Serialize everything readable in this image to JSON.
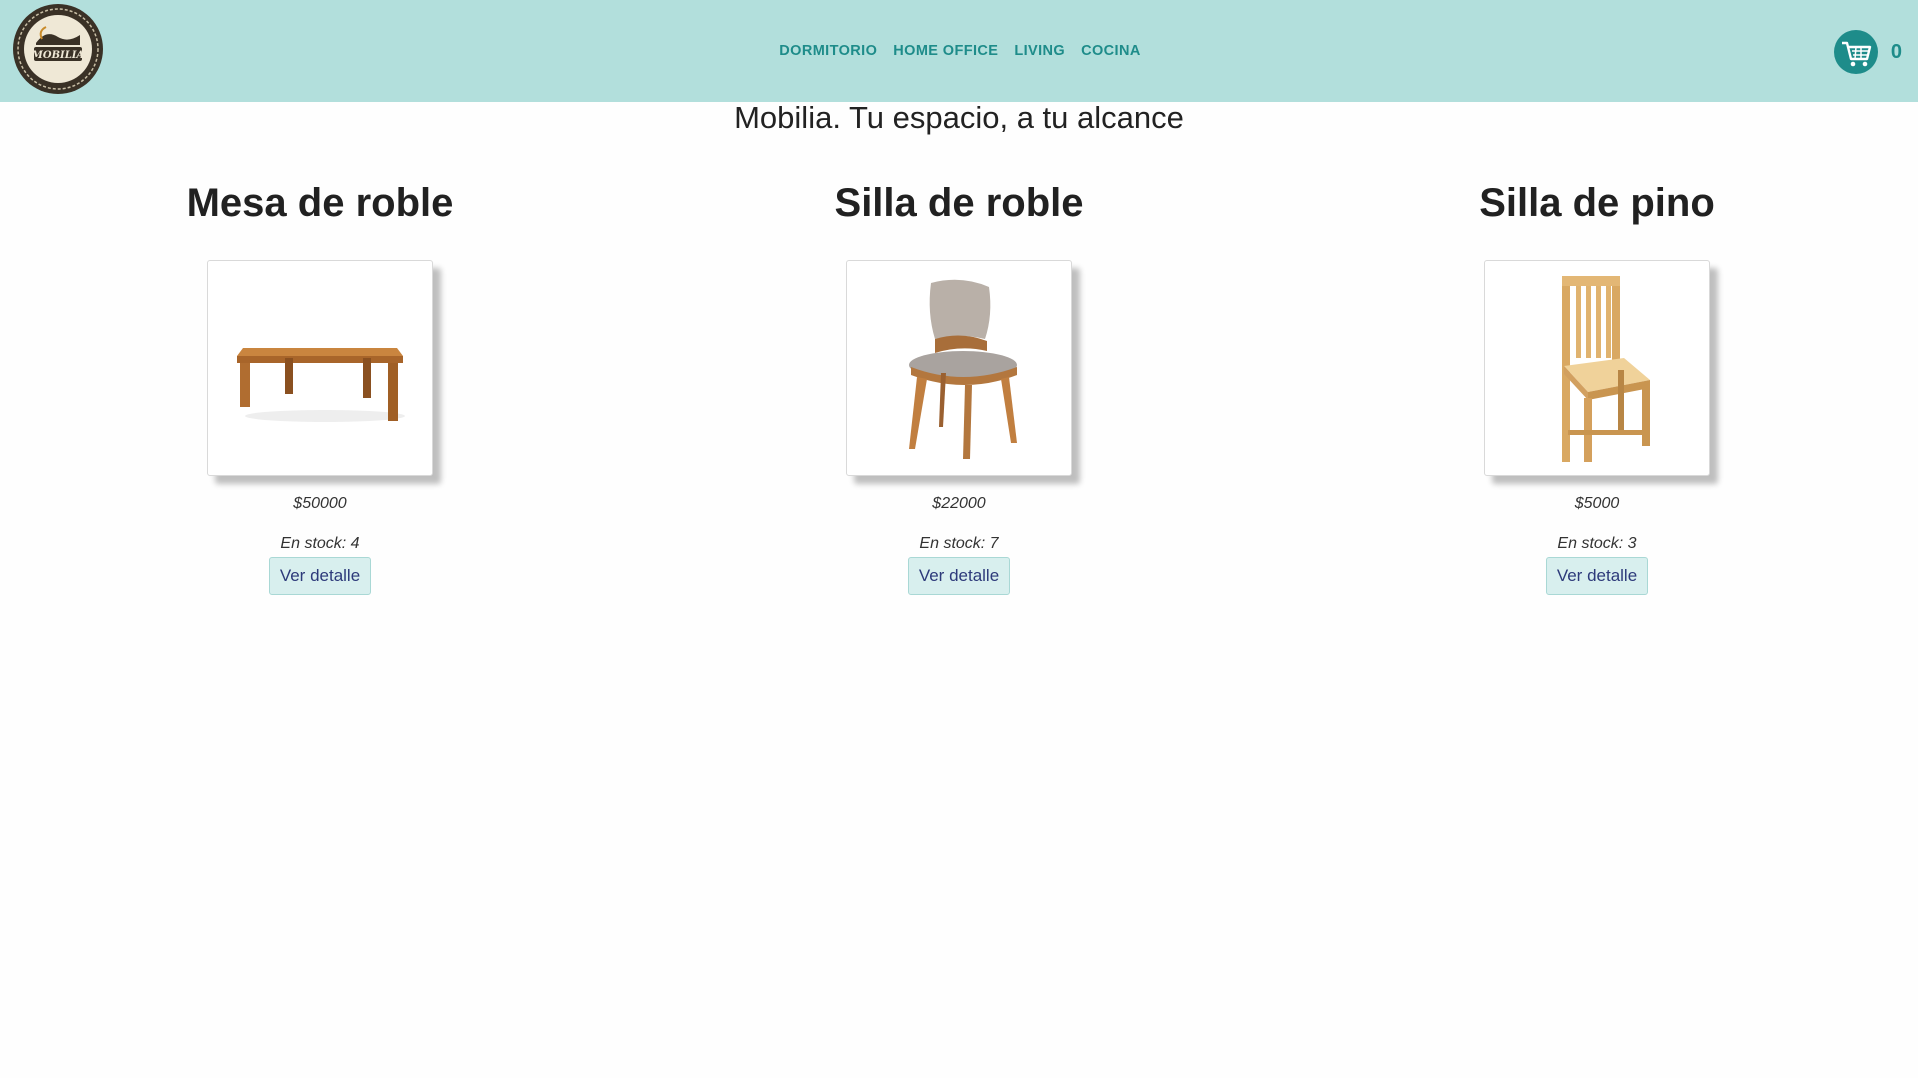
{
  "brand": {
    "logo_text": "MOBILIA"
  },
  "nav": {
    "items": [
      {
        "label": "DORMITORIO"
      },
      {
        "label": "HOME OFFICE"
      },
      {
        "label": "LIVING"
      },
      {
        "label": "COCINA"
      }
    ]
  },
  "cart": {
    "icon": "shopping-cart-icon",
    "count": "0"
  },
  "hero": {
    "title": "Mobilia. Tu espacio, a tu alcance"
  },
  "products": [
    {
      "name": "Mesa de roble",
      "price": "$50000",
      "stock": "En stock: 4",
      "button": "Ver detalle",
      "image": "oak-table"
    },
    {
      "name": "Silla de roble",
      "price": "$22000",
      "stock": "En stock: 7",
      "button": "Ver detalle",
      "image": "upholstered-oak-chair"
    },
    {
      "name": "Silla de pino",
      "price": "$5000",
      "stock": "En stock: 3",
      "button": "Ver detalle",
      "image": "pine-chair"
    }
  ],
  "colors": {
    "navbar_bg": "#b2dfdc",
    "nav_link": "#1e8c8a",
    "button_bg": "#d8efee",
    "button_text": "#2d3a7a"
  }
}
